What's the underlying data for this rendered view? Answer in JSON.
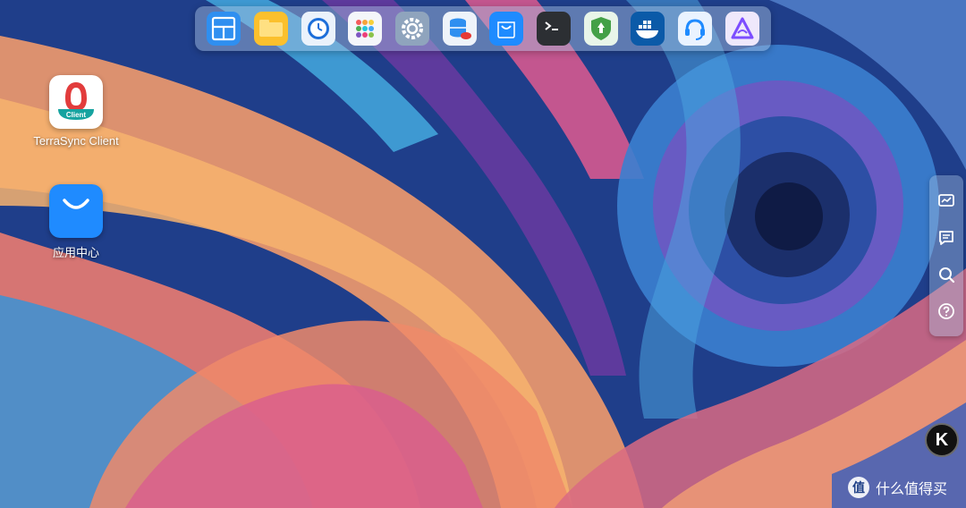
{
  "desktop": {
    "icons": [
      {
        "label": "TerraSync Client",
        "badge": "Client",
        "icon": "terrasync-client-icon"
      },
      {
        "label": "应用中心",
        "icon": "app-store-bag-icon"
      }
    ]
  },
  "dock": {
    "items": [
      "layout-grid-icon",
      "folder-icon",
      "clock-icon",
      "apps-grid-icon",
      "settings-gear-icon",
      "database-icon",
      "app-store-bag-icon",
      "terminal-icon",
      "security-shield-icon",
      "docker-whale-icon",
      "support-headset-icon",
      "triangle-app-icon"
    ]
  },
  "side_toolbar": {
    "items": [
      "monitor-chart-icon",
      "message-icon",
      "search-icon",
      "help-icon"
    ]
  },
  "avatar": {
    "letter": "K"
  },
  "watermark": {
    "logo": "值",
    "text": "什么值得买"
  },
  "colors": {
    "dock_bg": "#aac3e1",
    "accent_blue": "#1f8bff",
    "teal": "#16a3a0",
    "red": "#e23c3c"
  }
}
